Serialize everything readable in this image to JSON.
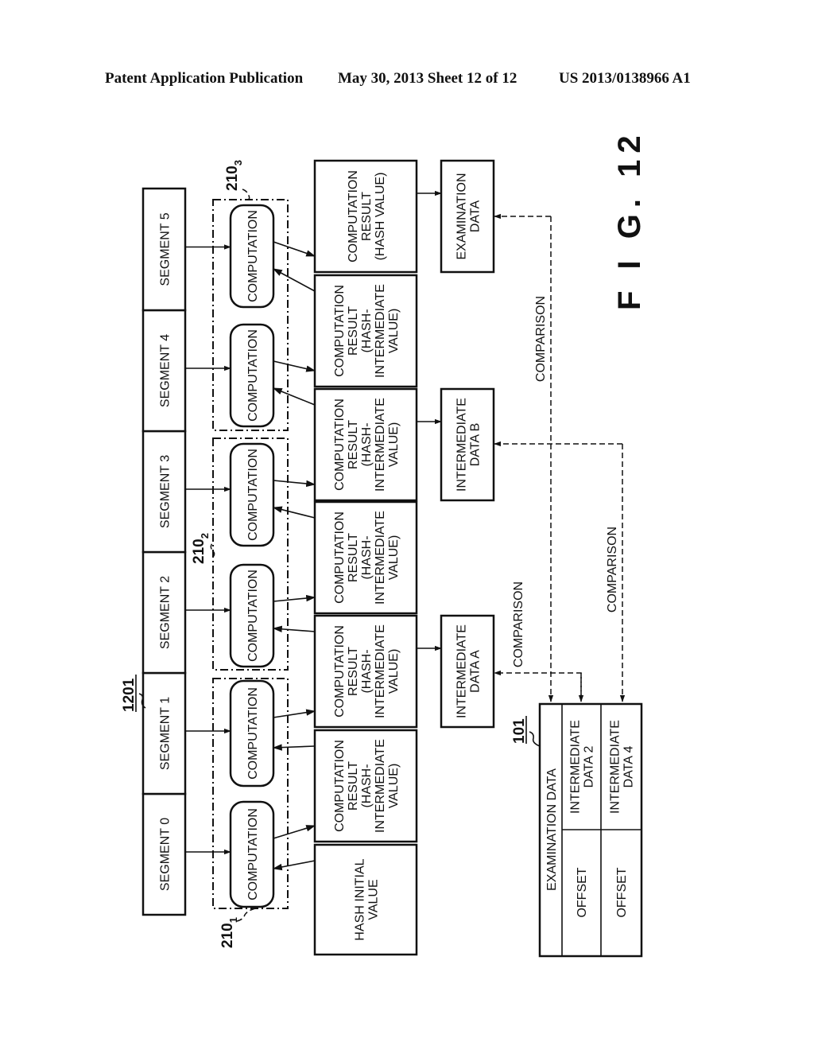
{
  "header": {
    "publication": "Patent Application Publication",
    "date_sheet": "May 30, 2013   Sheet 12 of 12",
    "patent_number": "US 2013/0138966 A1"
  },
  "figure": {
    "label": "F I G.  12",
    "refs": {
      "segment_group": "1201",
      "exam_table": "101",
      "unit_1_base": "210",
      "unit_1_sub": "1",
      "unit_2_base": "210",
      "unit_2_sub": "2",
      "unit_3_base": "210",
      "unit_3_sub": "3"
    },
    "segments": [
      "SEGMENT 0",
      "SEGMENT 1",
      "SEGMENT 2",
      "SEGMENT 3",
      "SEGMENT 4",
      "SEGMENT 5"
    ],
    "computation_label": "COMPUTATION",
    "results": [
      [
        "HASH INITIAL",
        "VALUE"
      ],
      [
        "COMPUTATION",
        "RESULT",
        "(HASH-",
        "INTERMEDIATE",
        "VALUE)"
      ],
      [
        "COMPUTATION",
        "RESULT",
        "(HASH-",
        "INTERMEDIATE",
        "VALUE)"
      ],
      [
        "COMPUTATION",
        "RESULT",
        "(HASH-",
        "INTERMEDIATE",
        "VALUE)"
      ],
      [
        "COMPUTATION",
        "RESULT",
        "(HASH-",
        "INTERMEDIATE",
        "VALUE)"
      ],
      [
        "COMPUTATION",
        "RESULT",
        "(HASH-",
        "INTERMEDIATE",
        "VALUE)"
      ],
      [
        "COMPUTATION",
        "RESULT",
        "(HASH VALUE)"
      ]
    ],
    "outputs": {
      "intermediate_a": [
        "INTERMEDIATE",
        "DATA A"
      ],
      "intermediate_b": [
        "INTERMEDIATE",
        "DATA B"
      ],
      "examination": [
        "EXAMINATION",
        "DATA"
      ]
    },
    "comparison_label": "COMPARISON",
    "exam_table": {
      "title": "EXAMINATION DATA",
      "rows": [
        {
          "offset": "OFFSET",
          "data": [
            "INTERMEDIATE",
            "DATA 2"
          ]
        },
        {
          "offset": "OFFSET",
          "data": [
            "INTERMEDIATE",
            "DATA 4"
          ]
        }
      ]
    }
  }
}
